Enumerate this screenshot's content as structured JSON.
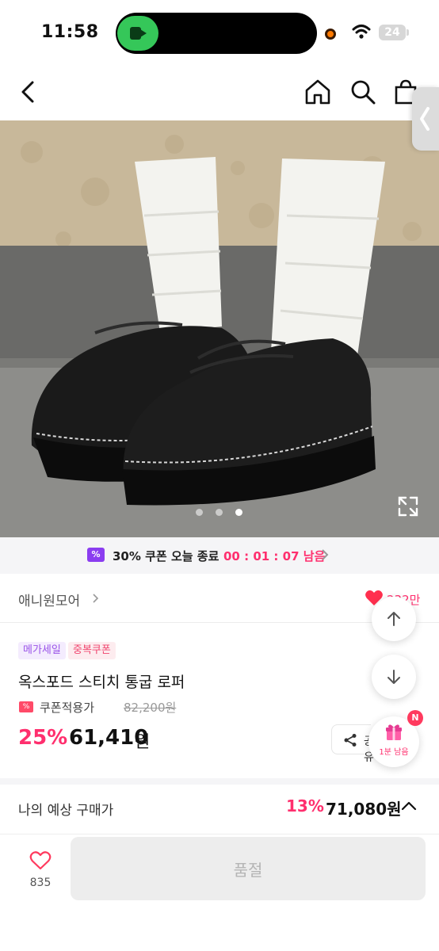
{
  "status_bar": {
    "time": "11:58",
    "battery": "24",
    "icons": [
      "video-camera-icon",
      "recording-dot-icon",
      "wifi-icon",
      "battery-icon"
    ]
  },
  "nav": {
    "icons": [
      "back-arrow-icon",
      "home-icon",
      "search-icon",
      "cart-icon",
      "side-panel-handle-icon"
    ]
  },
  "gallery": {
    "image_count": 3,
    "active_index": 3,
    "expand_icon": "expand-icon"
  },
  "coupon_banner": {
    "badge": "%",
    "text": "30% 쿠폰 오늘 종료",
    "countdown": "00 : 01 : 07 남음"
  },
  "store": {
    "name": "애니원모어",
    "likes": "232만"
  },
  "product": {
    "badges": [
      "메가세일",
      "중복쿠폰"
    ],
    "title": "옥스포드 스티치 통굽 로퍼",
    "coupon_label": "쿠폰적용가",
    "original_price": "82,200원",
    "discount": "25%",
    "price": "61,410",
    "price_unit": "원",
    "share_label": "공유"
  },
  "floating": {
    "gift_time": "1분 남음",
    "new_badge": "N"
  },
  "expected": {
    "label": "나의 예상 구매가",
    "discount": "13%",
    "price": "71,080원"
  },
  "bottom_bar": {
    "wish_count": "835",
    "soldout_label": "품절"
  },
  "colors": {
    "accent": "#ff2f6e",
    "coupon_purple": "#8b3df0",
    "soldout_bg": "#ededed"
  }
}
